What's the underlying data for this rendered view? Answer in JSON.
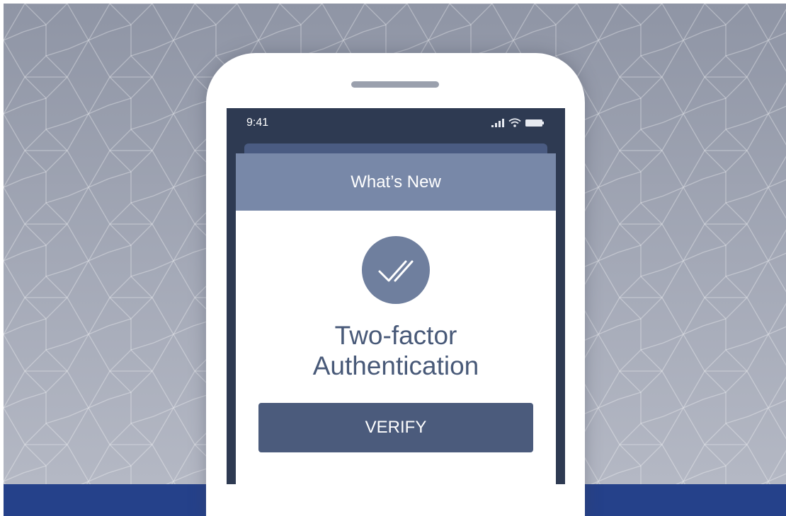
{
  "status_bar": {
    "time": "9:41",
    "icons": [
      "signal-icon",
      "wifi-icon",
      "battery-icon"
    ]
  },
  "dialog": {
    "header_title": "What’s New",
    "icon": "double-check-icon",
    "feature_title_line1": "Two-factor",
    "feature_title_line2": "Authentication",
    "verify_label": "VERIFY"
  },
  "colors": {
    "background_top": "#8f95a5",
    "background_bottom": "#b4b8c4",
    "bottom_bar": "#25418a",
    "screen": "#2e3a52",
    "card_header": "#7888a8",
    "check_circle": "#6f7f9e",
    "title_text": "#485978",
    "button": "#4b5b7c"
  }
}
